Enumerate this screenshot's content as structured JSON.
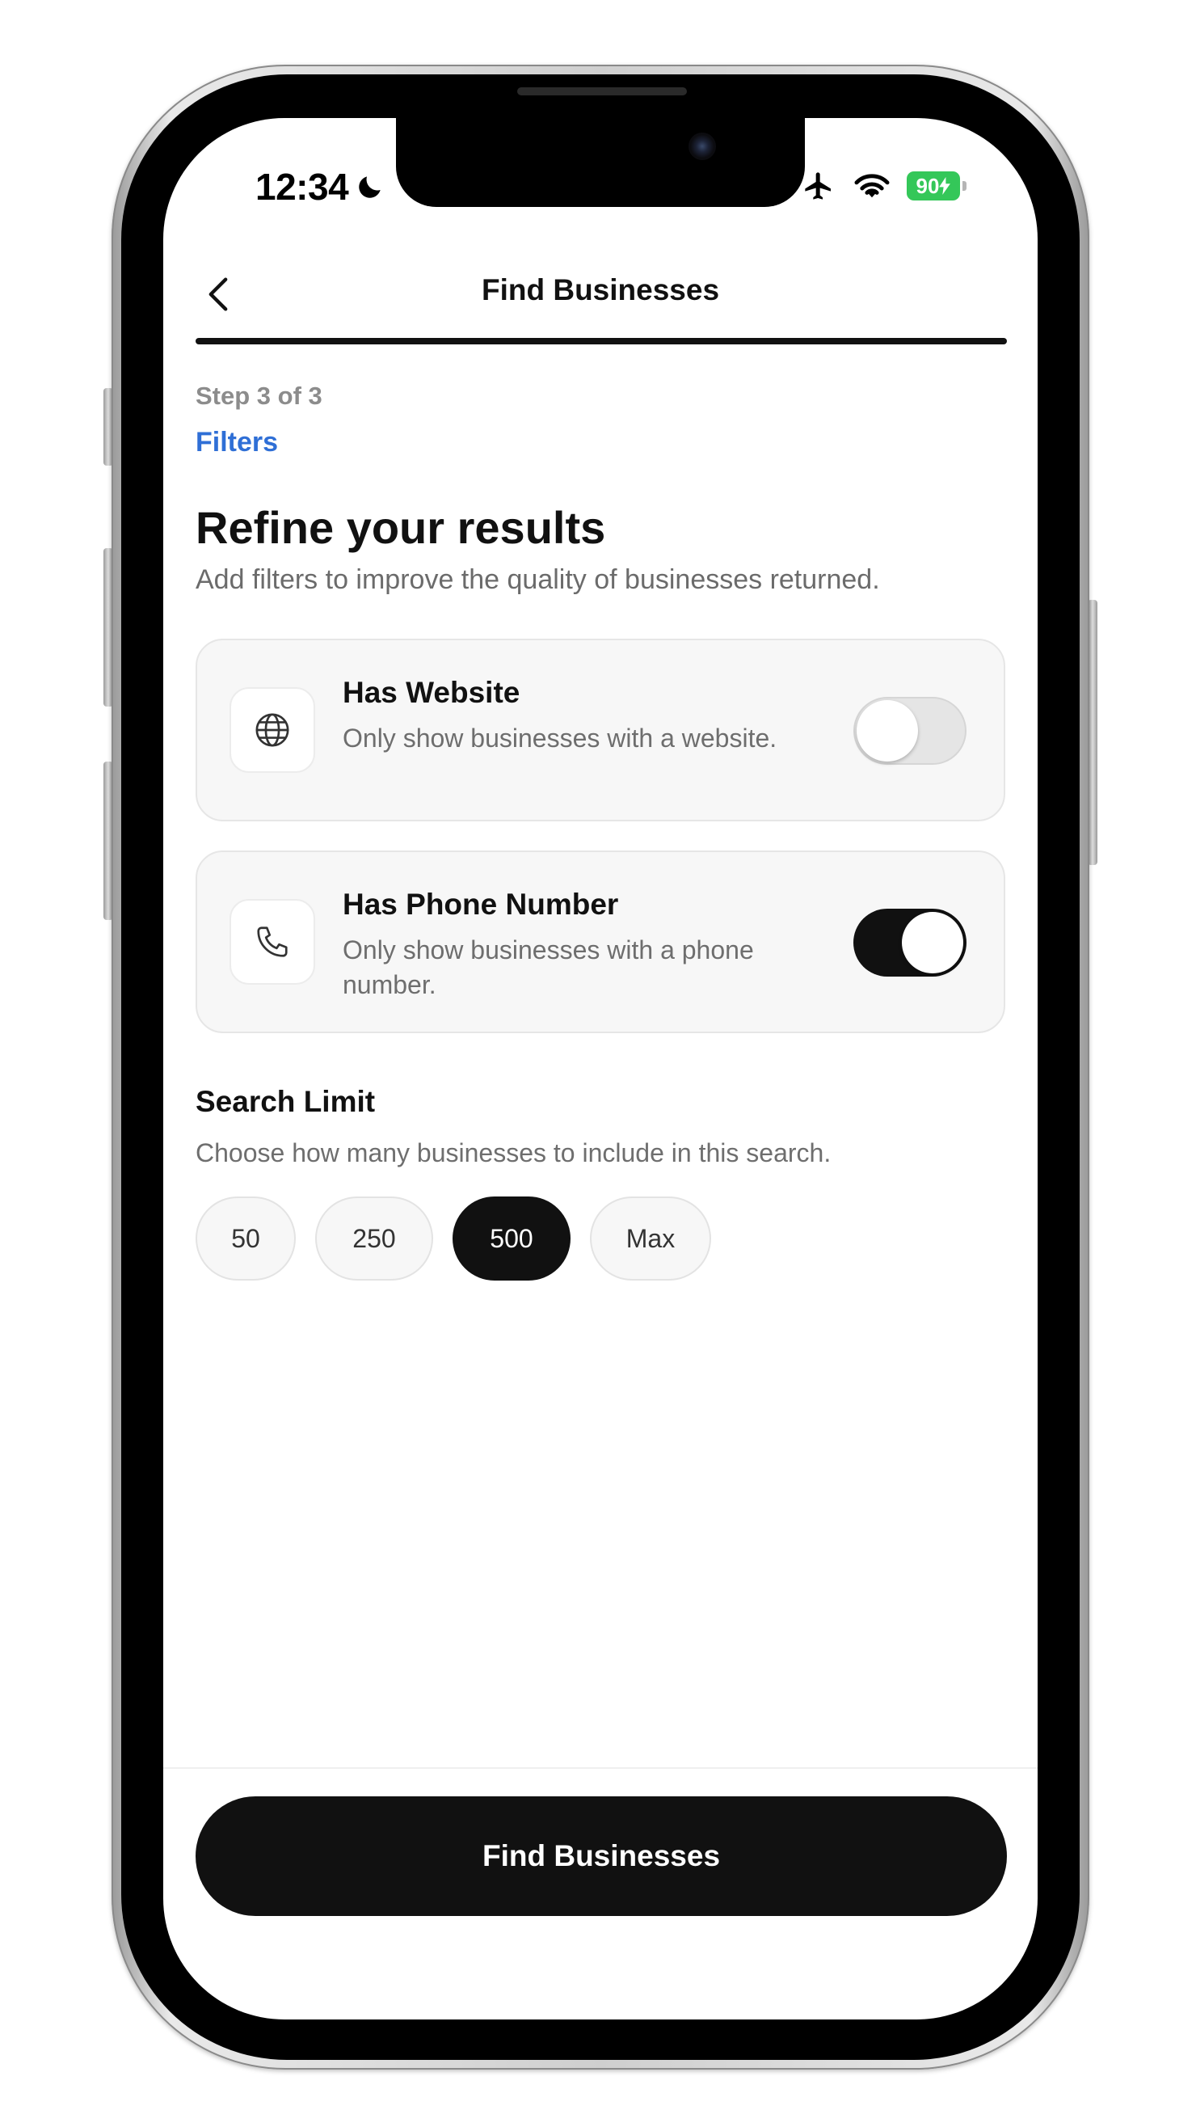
{
  "status_bar": {
    "time": "12:34",
    "battery": "90"
  },
  "header": {
    "title": "Find Businesses"
  },
  "progress": {
    "step_label": "Step 3 of 3",
    "step_name": "Filters",
    "fraction_complete": 1.0
  },
  "main": {
    "title": "Refine your results",
    "subtitle": "Add filters to improve the quality of businesses returned."
  },
  "filters": [
    {
      "icon": "globe-icon",
      "title": "Has Website",
      "description": "Only show businesses with a website.",
      "enabled": false
    },
    {
      "icon": "phone-icon",
      "title": "Has Phone Number",
      "description": "Only show businesses with a phone number.",
      "enabled": true
    }
  ],
  "search_limit": {
    "title": "Search Limit",
    "description": "Choose how many businesses to include in this search.",
    "options": [
      "50",
      "250",
      "500",
      "Max"
    ],
    "selected": "500"
  },
  "cta": {
    "label": "Find Businesses"
  },
  "colors": {
    "accent": "#2f6fd6",
    "primary": "#111111",
    "battery": "#34c759"
  }
}
